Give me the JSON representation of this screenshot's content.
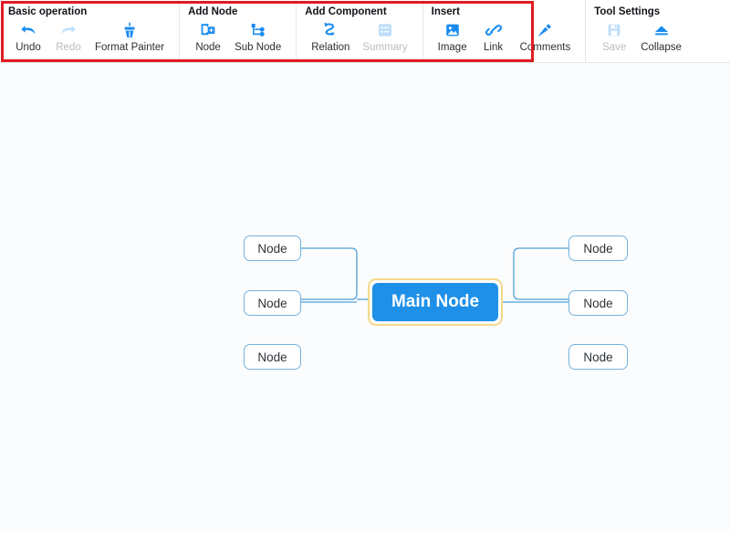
{
  "toolbar": {
    "groups": [
      {
        "title": "Basic operation",
        "items": [
          {
            "label": "Undo",
            "icon": "undo-arrow-icon",
            "disabled": false
          },
          {
            "label": "Redo",
            "icon": "redo-arrow-icon",
            "disabled": true
          },
          {
            "label": "Format Painter",
            "icon": "format-painter-icon",
            "disabled": false
          }
        ]
      },
      {
        "title": "Add Node",
        "items": [
          {
            "label": "Node",
            "icon": "add-node-icon",
            "disabled": false
          },
          {
            "label": "Sub Node",
            "icon": "add-sub-node-icon",
            "disabled": false
          }
        ]
      },
      {
        "title": "Add Component",
        "items": [
          {
            "label": "Relation",
            "icon": "relation-arrow-icon",
            "disabled": false
          },
          {
            "label": "Summary",
            "icon": "summary-list-icon",
            "disabled": true
          }
        ]
      },
      {
        "title": "Insert",
        "items": [
          {
            "label": "Image",
            "icon": "image-icon",
            "disabled": false
          },
          {
            "label": "Link",
            "icon": "link-chain-icon",
            "disabled": false
          },
          {
            "label": "Comments",
            "icon": "comments-pen-icon",
            "disabled": false
          }
        ]
      },
      {
        "title": "Tool Settings",
        "items": [
          {
            "label": "Save",
            "icon": "save-disk-icon",
            "disabled": true
          },
          {
            "label": "Collapse",
            "icon": "collapse-eject-icon",
            "disabled": false
          }
        ]
      }
    ]
  },
  "highlight": {
    "color": "#e01b22"
  },
  "mindmap": {
    "main_node": {
      "label": "Main Node"
    },
    "left_nodes": [
      {
        "label": "Node"
      },
      {
        "label": "Node"
      },
      {
        "label": "Node"
      }
    ],
    "right_nodes": [
      {
        "label": "Node"
      },
      {
        "label": "Node"
      },
      {
        "label": "Node"
      }
    ],
    "colors": {
      "main_fill": "#1e90e8",
      "main_selection_border": "#f3d98a",
      "node_border": "#74b2dd",
      "connector": "#4f9fd4",
      "canvas_background": "#fbfcfe"
    }
  }
}
